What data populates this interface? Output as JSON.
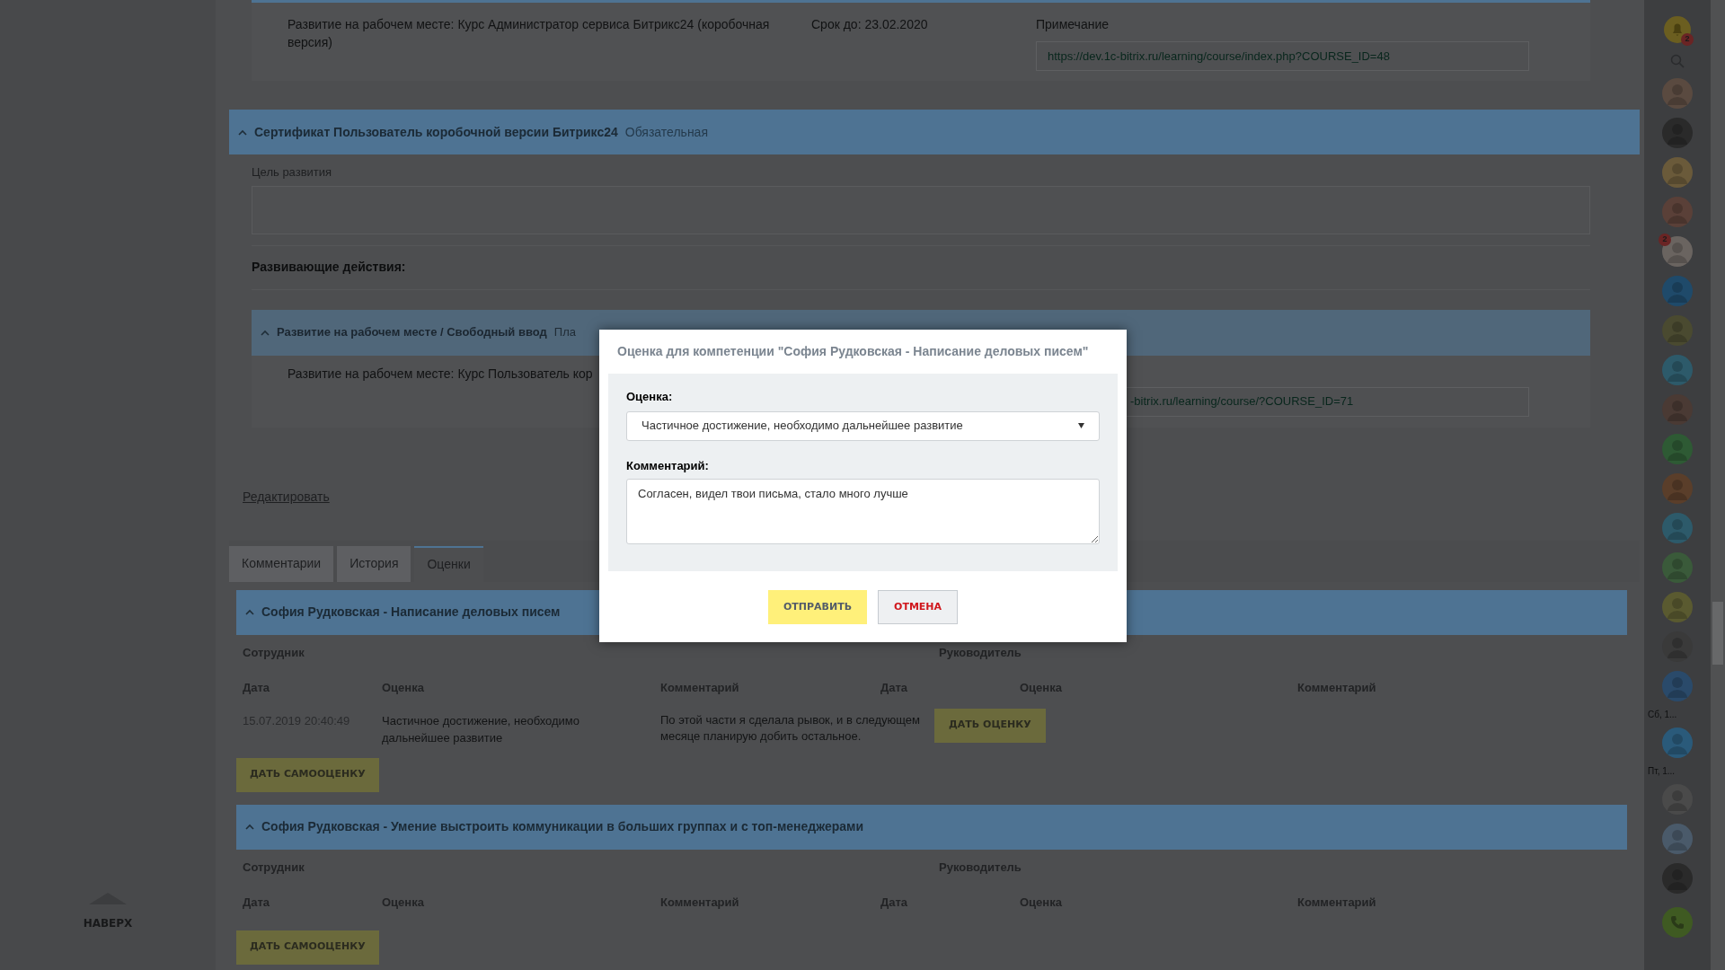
{
  "top_item": {
    "title": "Развитие на рабочем месте: Курс Администратор сервиса Битрикс24 (коробочная версия)",
    "deadline": "Срок до: 23.02.2020",
    "note_label": "Примечание",
    "note_value": "https://dev.1c-bitrix.ru/learning/course/index.php?COURSE_ID=48"
  },
  "section": {
    "expanded": true,
    "title": "Сертификат Пользователь коробочной версии Битрикс24",
    "status": "Обязательная",
    "goal_label": "Цель развития",
    "actions_label": "Развивающие действия:",
    "action": {
      "expanded": true,
      "title": "Развитие на рабочем месте / Свободный ввод",
      "status": "Пла",
      "item_title": "Развитие на рабочем месте: Курс Пользователь кор",
      "note_value": "-bitrix.ru/learning/course/?COURSE_ID=71"
    }
  },
  "edit_link": "Редактировать",
  "tabs": [
    {
      "label": "Комментарии",
      "selected": false
    },
    {
      "label": "История",
      "selected": false
    },
    {
      "label": "Оценки",
      "selected": true
    }
  ],
  "assessments": [
    {
      "expanded": true,
      "title": "София Рудковская - Написание деловых писем",
      "employee_label": "Сотрудник",
      "manager_label": "Руководитель",
      "columns": [
        "Дата",
        "Оценка",
        "Комментарий",
        "Дата",
        "Оценка",
        "Комментарий"
      ],
      "rows": [
        {
          "date": "15.07.2019 20:40:49",
          "grade": "Частичное достижение, необходимо дальнейшее развитие",
          "comment": "По этой части я сделала рывок, и в следующем месяце планирую добить остальное.",
          "action": "ДАТЬ ОЦЕНКУ"
        }
      ],
      "button": "ДАТЬ САМООЦЕНКУ"
    },
    {
      "expanded": true,
      "title": "София Рудковская - Умение выстроить коммуникации в больших группах и с топ-менеджерами",
      "employee_label": "Сотрудник",
      "manager_label": "Руководитель",
      "columns": [
        "Дата",
        "Оценка",
        "Комментарий",
        "Дата",
        "Оценка",
        "Комментарий"
      ],
      "button": "ДАТЬ САМООЦЕНКУ"
    }
  ],
  "back_to_top": "НАВЕРХ",
  "sidebar": [
    {
      "kind": "bell",
      "badge": "2"
    },
    {
      "kind": "search"
    },
    {
      "kind": "avatar"
    },
    {
      "kind": "avatar"
    },
    {
      "kind": "avatar"
    },
    {
      "kind": "avatar"
    },
    {
      "kind": "avatar",
      "badge": "2"
    },
    {
      "kind": "avatar"
    },
    {
      "kind": "avatar"
    },
    {
      "kind": "avatar"
    },
    {
      "kind": "avatar"
    },
    {
      "kind": "avatar"
    },
    {
      "kind": "avatar"
    },
    {
      "kind": "avatar"
    },
    {
      "kind": "avatar"
    },
    {
      "kind": "avatar"
    },
    {
      "kind": "avatar"
    },
    {
      "kind": "avatar"
    },
    {
      "kind": "date",
      "text": "Сб, 1..."
    },
    {
      "kind": "avatar"
    },
    {
      "kind": "date",
      "text": "Пт, 1..."
    },
    {
      "kind": "avatar"
    },
    {
      "kind": "avatar"
    },
    {
      "kind": "avatar"
    },
    {
      "kind": "phone"
    }
  ],
  "dialog": {
    "title": "Оценка для компетенции \"София Рудковская - Написание деловых писем\"",
    "grade_label": "Оценка:",
    "grade_value": "Частичное достижение, необходимо дальнейшее развитие",
    "comment_label": "Комментарий:",
    "comment_value": "Согласен, видел твои письма, стало много лучше",
    "buttons": [
      {
        "label": "ОТПРАВИТЬ",
        "kind": "primary"
      },
      {
        "label": "ОТМЕНА",
        "kind": "cancel"
      }
    ]
  }
}
